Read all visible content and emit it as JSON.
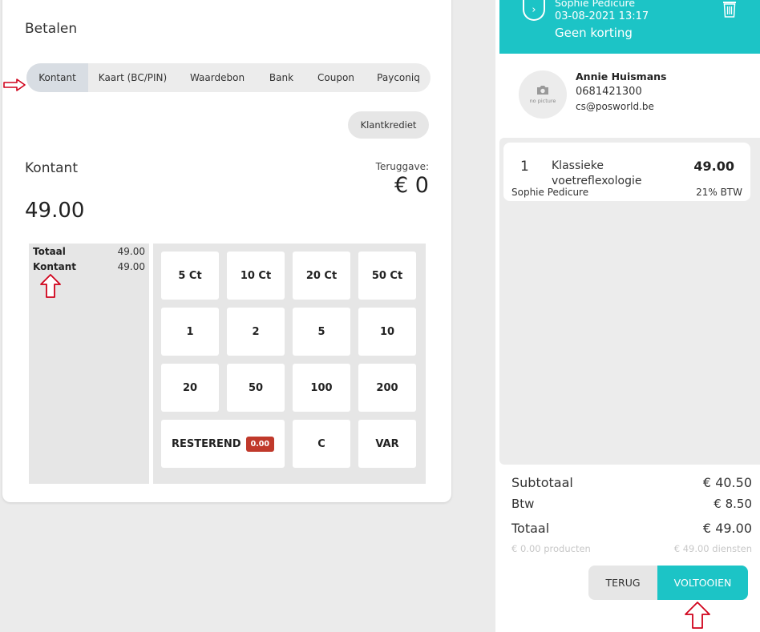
{
  "payment": {
    "title": "Betalen",
    "tabs": [
      {
        "label": "Kontant"
      },
      {
        "label": "Kaart (BC/PIN)"
      },
      {
        "label": "Waardebon"
      },
      {
        "label": "Bank"
      },
      {
        "label": "Coupon"
      },
      {
        "label": "Payconiq"
      }
    ],
    "klantkrediet_label": "Klantkrediet",
    "method_label": "Kontant",
    "amount": "49.00",
    "change_label": "Teruggave:",
    "change_value": "€ 0",
    "summary": [
      {
        "label": "Totaal",
        "value": "49.00"
      },
      {
        "label": "Kontant",
        "value": "49.00"
      }
    ],
    "keypad": {
      "row1": [
        "5 Ct",
        "10 Ct",
        "20 Ct",
        "50 Ct"
      ],
      "row2": [
        "1",
        "2",
        "5",
        "10"
      ],
      "row3": [
        "20",
        "50",
        "100",
        "200"
      ],
      "remaining_label": "RESTEREND",
      "remaining_badge": "0.00",
      "clear_label": "C",
      "var_label": "VAR"
    }
  },
  "order": {
    "staff_name": "Sophie Pedicure",
    "datetime": "03-08-2021 13:17",
    "discount": "Geen korting",
    "customer": {
      "avatar_text": "no picture",
      "name": "Annie Huismans",
      "phone": "0681421300",
      "email": "cs@posworld.be"
    },
    "items": [
      {
        "qty": "1",
        "name": "Klassieke voetreflexologie",
        "price": "49.00",
        "staff": "Sophie Pedicure",
        "vat": "21% BTW"
      }
    ],
    "subtotal_label": "Subtotaal",
    "subtotal_value": "€ 40.50",
    "vat_label": "Btw",
    "vat_value": "€ 8.50",
    "total_label": "Totaal",
    "total_value": "€ 49.00",
    "products_total": "€ 0.00 producten",
    "services_total": "€ 49.00 diensten",
    "back_label": "TERUG",
    "complete_label": "VOLTOOIEN"
  },
  "colors": {
    "accent": "#1cc4c6",
    "badge": "#c0392b",
    "arrow": "#d0021b"
  }
}
